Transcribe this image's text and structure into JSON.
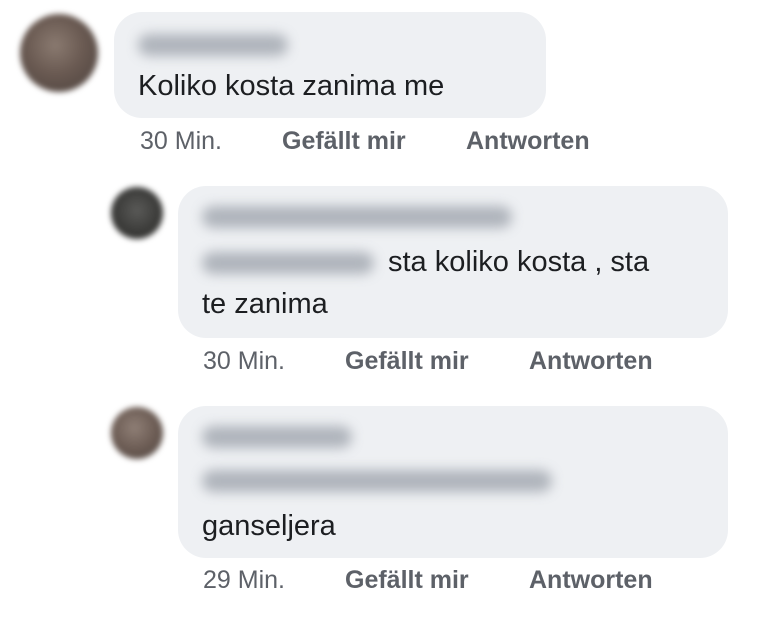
{
  "comments": [
    {
      "text_lines": [
        "Koliko  kosta zanima me"
      ],
      "time": "30 Min.",
      "like": "Gefällt mir",
      "reply": "Antworten"
    },
    {
      "text_lines": [
        "sta koliko kosta , sta",
        "te zanima"
      ],
      "time": "30 Min.",
      "like": "Gefällt mir",
      "reply": "Antworten"
    },
    {
      "text_lines": [
        "ganseljera"
      ],
      "time": "29 Min.",
      "like": "Gefällt mir",
      "reply": "Antworten"
    }
  ]
}
